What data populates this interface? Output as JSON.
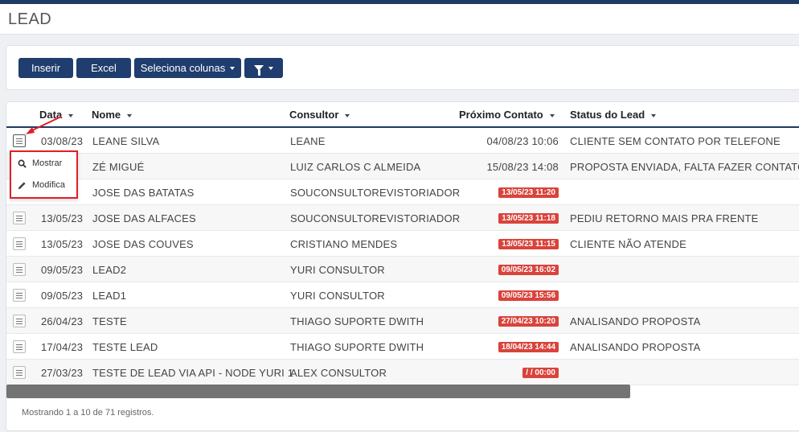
{
  "page": {
    "title": "LEAD"
  },
  "toolbar": {
    "inserir_label": "Inserir",
    "excel_label": "Excel",
    "colunas_label": "Seleciona colunas"
  },
  "table": {
    "columns": [
      "Data",
      "Nome",
      "Consultor",
      "Próximo Contato",
      "Status do Lead"
    ],
    "rows": [
      {
        "data": "03/08/23",
        "nome": "LEANE SILVA",
        "consultor": "LEANE",
        "proximo": "04/08/23 10:06",
        "overdue": false,
        "status": "CLIENTE SEM CONTATO POR TELEFONE"
      },
      {
        "data": "",
        "nome": "ZÉ MIGUÉ",
        "consultor": "LUIZ CARLOS C ALMEIDA",
        "proximo": "15/08/23 14:08",
        "overdue": false,
        "status": "PROPOSTA ENVIADA, FALTA FAZER CONTATO"
      },
      {
        "data": "",
        "nome": "JOSE DAS BATATAS",
        "consultor": "SOUCONSULTOREVISTORIADOR",
        "proximo": "13/05/23 11:20",
        "overdue": true,
        "status": ""
      },
      {
        "data": "13/05/23",
        "nome": "JOSE DAS ALFACES",
        "consultor": "SOUCONSULTOREVISTORIADOR",
        "proximo": "13/05/23 11:18",
        "overdue": true,
        "status": "PEDIU RETORNO MAIS PRA FRENTE"
      },
      {
        "data": "13/05/23",
        "nome": "JOSE DAS COUVES",
        "consultor": "CRISTIANO MENDES",
        "proximo": "13/05/23 11:15",
        "overdue": true,
        "status": "CLIENTE NÃO ATENDE"
      },
      {
        "data": "09/05/23",
        "nome": "LEAD2",
        "consultor": "YURI CONSULTOR",
        "proximo": "09/05/23 16:02",
        "overdue": true,
        "status": ""
      },
      {
        "data": "09/05/23",
        "nome": "LEAD1",
        "consultor": "YURI CONSULTOR",
        "proximo": "09/05/23 15:56",
        "overdue": true,
        "status": ""
      },
      {
        "data": "26/04/23",
        "nome": "TESTE",
        "consultor": "THIAGO SUPORTE DWITH",
        "proximo": "27/04/23 10:20",
        "overdue": true,
        "status": "ANALISANDO PROPOSTA"
      },
      {
        "data": "17/04/23",
        "nome": "TESTE LEAD",
        "consultor": "THIAGO SUPORTE DWITH",
        "proximo": "18/04/23 14:44",
        "overdue": true,
        "status": "ANALISANDO PROPOSTA"
      },
      {
        "data": "27/03/23",
        "nome": "TESTE DE LEAD VIA API - NODE YURI 1",
        "consultor": "ALEX CONSULTOR",
        "proximo": "/ / 00:00",
        "overdue": true,
        "status": ""
      }
    ],
    "footer": "Mostrando 1 a 10 de 71 registros."
  },
  "row_menu": {
    "mostrar_label": "Mostrar",
    "modifica_label": "Modifica"
  },
  "colors": {
    "primary": "#1f3d6e",
    "overdue_badge": "#d9433b",
    "highlight": "#e01f26"
  }
}
